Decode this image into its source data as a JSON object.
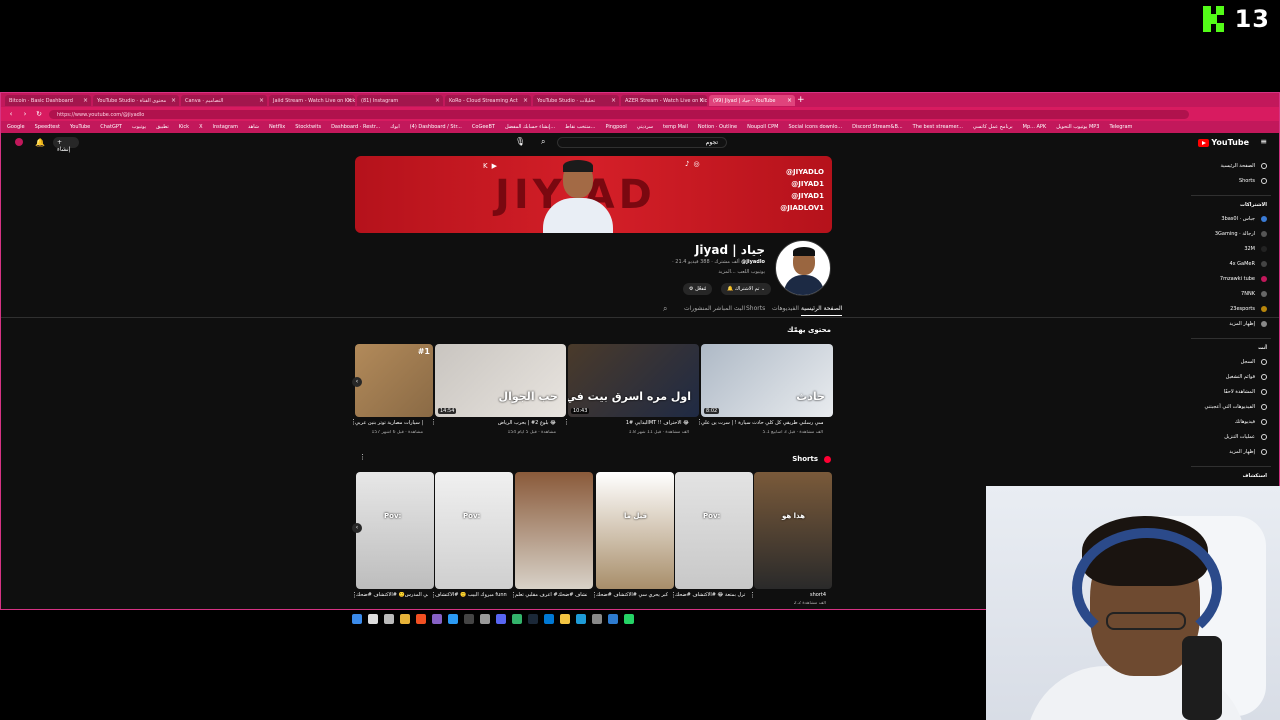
{
  "kick": {
    "count": "13",
    "logo_icon": "kick-logo-icon"
  },
  "browser": {
    "tabs": [
      {
        "label": "Bitcoin · Basic Dashboard"
      },
      {
        "label": "YouTube Studio · محتوى القناة"
      },
      {
        "label": "Canva · التصاميم"
      },
      {
        "label": "Jaiid Stream - Watch Live on Kick"
      },
      {
        "label": "(81) Instagram"
      },
      {
        "label": "KoRo - Cloud Streaming Act"
      },
      {
        "label": "YouTube Studio · تحليلات"
      },
      {
        "label": "AZER Stream - Watch Live on Kick"
      },
      {
        "label": "(99) Jiyad | جياد - YouTube",
        "active": true
      }
    ],
    "new_tab": "+",
    "url": "https://www.youtube.com/@jiyadlo",
    "bookmarks": [
      "Google",
      "Speedtest",
      "YouTube",
      "ChatGPT",
      "يوتيوب",
      "تطبيق",
      "Kick",
      "X",
      "Instagram",
      "شاهد",
      "Netflix",
      "Stocktwits",
      "Dashboard · Restr...",
      "ابوك",
      "(4) Dashboard / Str...",
      "CoGeeBT",
      "إنشاء حسابك المفضل...",
      "منتخب نقاط...",
      "Pingpool",
      "سرديتي",
      "temp Mail",
      "Notion · Outline",
      "Noupoll CPM",
      "Social icons downlo...",
      "Discord Stream&B...",
      "The best streamer...",
      "برنامج عمل كاتسي",
      "Mp... APK",
      "يوتيوب التحويل MP3",
      "Telegram"
    ]
  },
  "youtube": {
    "create_label": "إنشاء",
    "search_value": "تجوم",
    "logo_text": "YouTube",
    "banner": {
      "word": "JIY AD",
      "handles": [
        "@JIYADLO",
        "@JIYAD1",
        "@JIYAD1",
        "@JIADLOV1"
      ]
    },
    "channel": {
      "name": "Jiyad | جياد",
      "handle": "@jiyadlo",
      "stats": "· 21.4 ألف مشترك · 388 فيديو",
      "description": "يوتيوب اللعب ...المزيد",
      "subscribe_label": "تم الاشتراك",
      "customize_label": "مُفعّل"
    },
    "tabs": [
      {
        "label": "الصفحة الرئيسية",
        "selected": true
      },
      {
        "label": "الفيديوهات"
      },
      {
        "label": "Shorts"
      },
      {
        "label": "البث المباشر"
      },
      {
        "label": "المنشورات"
      }
    ],
    "for_you": {
      "title": "محتوى يهمّك",
      "videos": [
        {
          "overlay": "حادث",
          "duration": "8:02",
          "title": "عل سندق الفلسي رسلني طريقي كل كلي حادث سيارة ! | سرت ين علي 😂",
          "meta": "5.1 ألف مشاهدة · قبل 3 أسابيع",
          "colors": [
            "#aeb9c6",
            "#e9ecef"
          ]
        },
        {
          "overlay": "اول مره اسرق بيت في",
          "duration": "10:43",
          "title": "البدايي #1 ‏MT !! الاحتراف 😂",
          "meta": "1.8 ألف مشاهدة · قبل 11 شهر",
          "colors": [
            "#4a3a2a",
            "#1f2a44"
          ]
        },
        {
          "overlay": "حب الجوال",
          "duration": "14:54",
          "title": "بلوغ 2# | بحرب الرياض 😂",
          "meta": "154 مشاهدة · قبل 5 أيام",
          "colors": [
            "#c9c5c0",
            "#e8e4df"
          ]
        },
        {
          "overlay": "",
          "duration": "",
          "title": "الوك الاداخ | سيارات مصارية توتر بنين عربي",
          "meta": "157 مشاهدة · قبل 6 أشهر",
          "colors": [
            "#b28a5a",
            "#8a6a45"
          ],
          "rank": "#1"
        }
      ]
    },
    "shorts": {
      "title": "Shorts",
      "items": [
        {
          "overlay": "هذا هو",
          "title": "short4",
          "meta": "2.2 ألف مشاهدة",
          "colors": [
            "#7a5a3a",
            "#2a2a2a"
          ]
        },
        {
          "overlay": "Pov:",
          "title": "احر مقلب ترل بمتعة 😂 #الاكتشاف #ضحك",
          "meta": "",
          "colors": [
            "#e3e3e3",
            "#c8c8c8"
          ]
        },
        {
          "overlay": "قبل ما",
          "title": "المقلب الاكبر يحري سي #الاكتشاف #ضحك",
          "meta": "",
          "colors": [
            "#ffffff",
            "#a88e6a"
          ]
        },
        {
          "overlay": "",
          "title": "اعرف مقلبي تعلم ‎#الاكتشاف #ضحك",
          "meta": "",
          "colors": [
            "#8a5a3a",
            "#d8d2c8"
          ]
        },
        {
          "overlay": "Pov:",
          "title": "مبروك البيب 🙁 #الاكتشاف funny# #ضحك",
          "meta": "",
          "colors": [
            "#f0f0f0",
            "#cfcfcf"
          ]
        },
        {
          "overlay": "Pov:",
          "title": "نتوك على اكلي عالي المدرس🙁 #الاكتشاف #ضحك",
          "meta": "",
          "colors": [
            "#e7e7e7",
            "#bdbdbd"
          ]
        }
      ]
    },
    "sidebar": {
      "main": [
        {
          "label": "الصفحة الرئيسية",
          "icon": "home-icon"
        },
        {
          "label": "Shorts",
          "icon": "shorts-icon"
        }
      ],
      "subscriptions_title": "الاشتراكات",
      "subscriptions": [
        {
          "label": "3bas0l · جباس",
          "color": "#3a7bd5"
        },
        {
          "label": "3Gaming · ارجالة",
          "color": "#555"
        },
        {
          "label": "32M",
          "color": "#222"
        },
        {
          "label": "4x GaMeR",
          "color": "#444"
        },
        {
          "label": "7mzawki tube",
          "color": "#c2185b"
        },
        {
          "label": "7NNK",
          "color": "#666"
        },
        {
          "label": "23esports",
          "color": "#b8860b"
        },
        {
          "label": "إظهار المزيد",
          "color": "#888"
        }
      ],
      "you_title": "أنت",
      "you": [
        {
          "label": "السجل",
          "icon": "history-icon"
        },
        {
          "label": "قوائم التشغيل",
          "icon": "playlist-icon"
        },
        {
          "label": "المشاهدة لاحقًا",
          "icon": "watch-later-icon"
        },
        {
          "label": "الفيديوهات التي أعجبتني",
          "icon": "like-icon"
        },
        {
          "label": "فيديوهاتك",
          "icon": "video-icon"
        },
        {
          "label": "عمليات التنزيل",
          "icon": "download-icon"
        },
        {
          "label": "إظهار المزيد",
          "icon": "chevron-down-icon"
        }
      ],
      "explore_title": "استكشاف"
    }
  },
  "taskbar": {
    "icons": [
      "windows-icon",
      "search-icon",
      "taskview-icon",
      "files-icon",
      "chrome-icon",
      "editor-icon",
      "vscode-icon",
      "obs-icon",
      "settings-icon",
      "discord-icon",
      "app-icon",
      "steam-icon",
      "store-icon",
      "folder-icon",
      "edge-icon",
      "settings2-icon",
      "vpn-icon",
      "whatsapp-icon"
    ]
  },
  "webcam": {
    "subject": "streamer-webcam"
  }
}
